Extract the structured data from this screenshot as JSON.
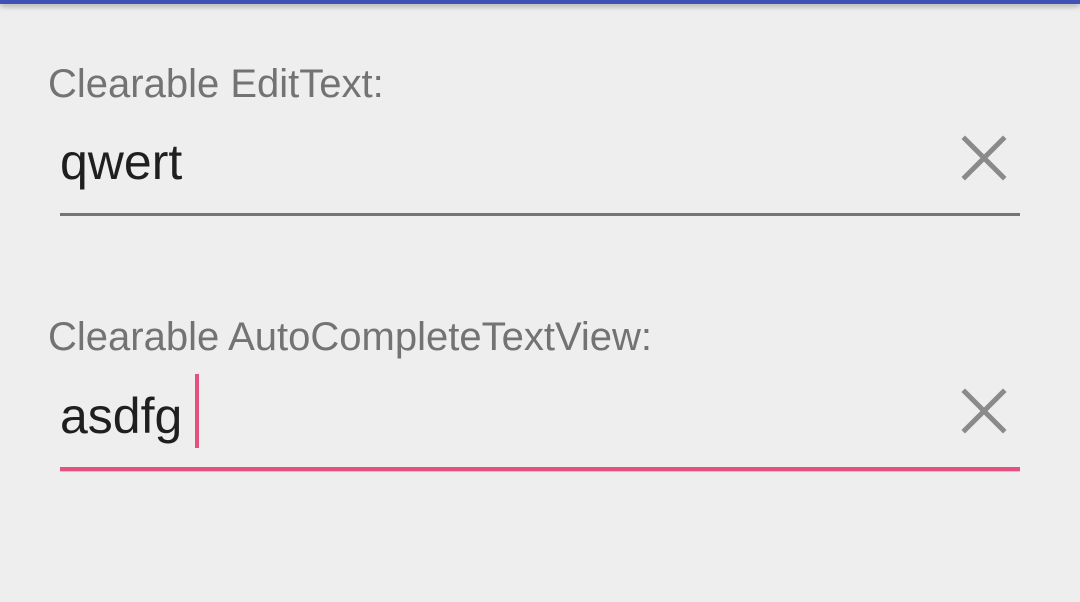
{
  "edittext": {
    "label": "Clearable EditText:",
    "value": "qwert"
  },
  "autocomplete": {
    "label": "Clearable AutoCompleteTextView:",
    "value": "asdfg"
  },
  "icons": {
    "clear": "close-icon"
  },
  "colors": {
    "primary": "#3f51b5",
    "accent": "#e5517f",
    "underline": "#757575",
    "label_text": "#737373",
    "input_text": "#1f1f1f",
    "icon": "#8a8a8a",
    "background": "#eeeeee"
  }
}
